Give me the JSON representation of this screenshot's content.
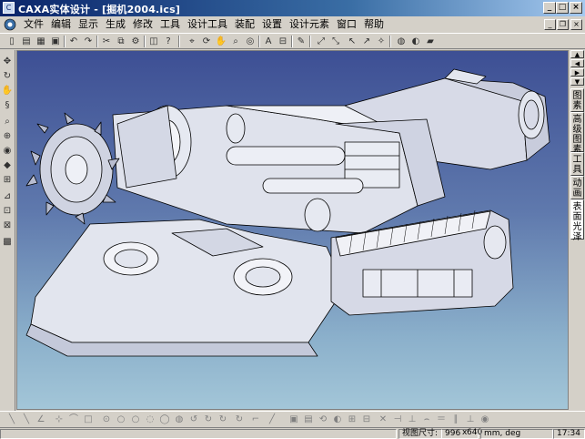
{
  "window": {
    "title": "CAXA实体设计 - [掘机2004.ics]",
    "app_icon": "caxa-app-icon",
    "controls": [
      "minimize",
      "maximize",
      "close"
    ]
  },
  "menubar": {
    "items": [
      "文件",
      "编辑",
      "显示",
      "生成",
      "修改",
      "工具",
      "设计工具",
      "装配",
      "设置",
      "设计元素",
      "窗口",
      "帮助"
    ]
  },
  "toolbar": {
    "icons": [
      "new-doc-icon",
      "open-icon",
      "save-icon",
      "new-design-icon",
      "save-as-icon",
      "undo-icon",
      "redo-icon",
      "design-element-icon",
      "view-icon",
      "help-icon",
      "pick-icon",
      "rotate-icon",
      "pan-icon",
      "zoom-icon",
      "orbit-icon",
      "text-icon",
      "measure-icon",
      "render-icon",
      "light-icon",
      "smart-snap-icon",
      "selection-icon",
      "camera-icon",
      "lights-icon",
      "view-orbit-icon",
      "material-icon",
      "surface-icon"
    ]
  },
  "left_toolbar": {
    "icons": [
      "move-icon",
      "spin-icon",
      "pan-icon",
      "zoom-icon",
      "zoom-in-icon",
      "orbit-icon",
      "dynamic-view-icon",
      "fit-icon",
      "walk-icon",
      "angle-icon",
      "pointer-icon",
      "extent-icon"
    ]
  },
  "right_panel": {
    "tabs": [
      "图素",
      "高级图素",
      "工具",
      "动画",
      "表面光泽"
    ],
    "active_tab": "表面光泽"
  },
  "bottom_toolbar": {
    "icons": [
      "line-icon",
      "line-2-icon",
      "angle-line-icon",
      "point-icon",
      "arc-icon",
      "rect-icon",
      "circle-icon",
      "circle2-icon",
      "circle3-icon",
      "arc2-icon",
      "ellipse-icon",
      "spline-icon",
      "fillet-icon",
      "chamfer-icon",
      "trim-icon",
      "extend-icon",
      "offset-icon",
      "move-icon",
      "copy-icon",
      "rotate-icon",
      "mirror-icon",
      "scale-icon",
      "array-icon",
      "constraint-icon",
      "dim-icon",
      "show-icon"
    ]
  },
  "statusbar": {
    "view_size_label": "视图尺寸:",
    "view_width": "996",
    "x_sep": "x",
    "view_height": "640",
    "units": "mm, deg",
    "time": "17:34"
  }
}
